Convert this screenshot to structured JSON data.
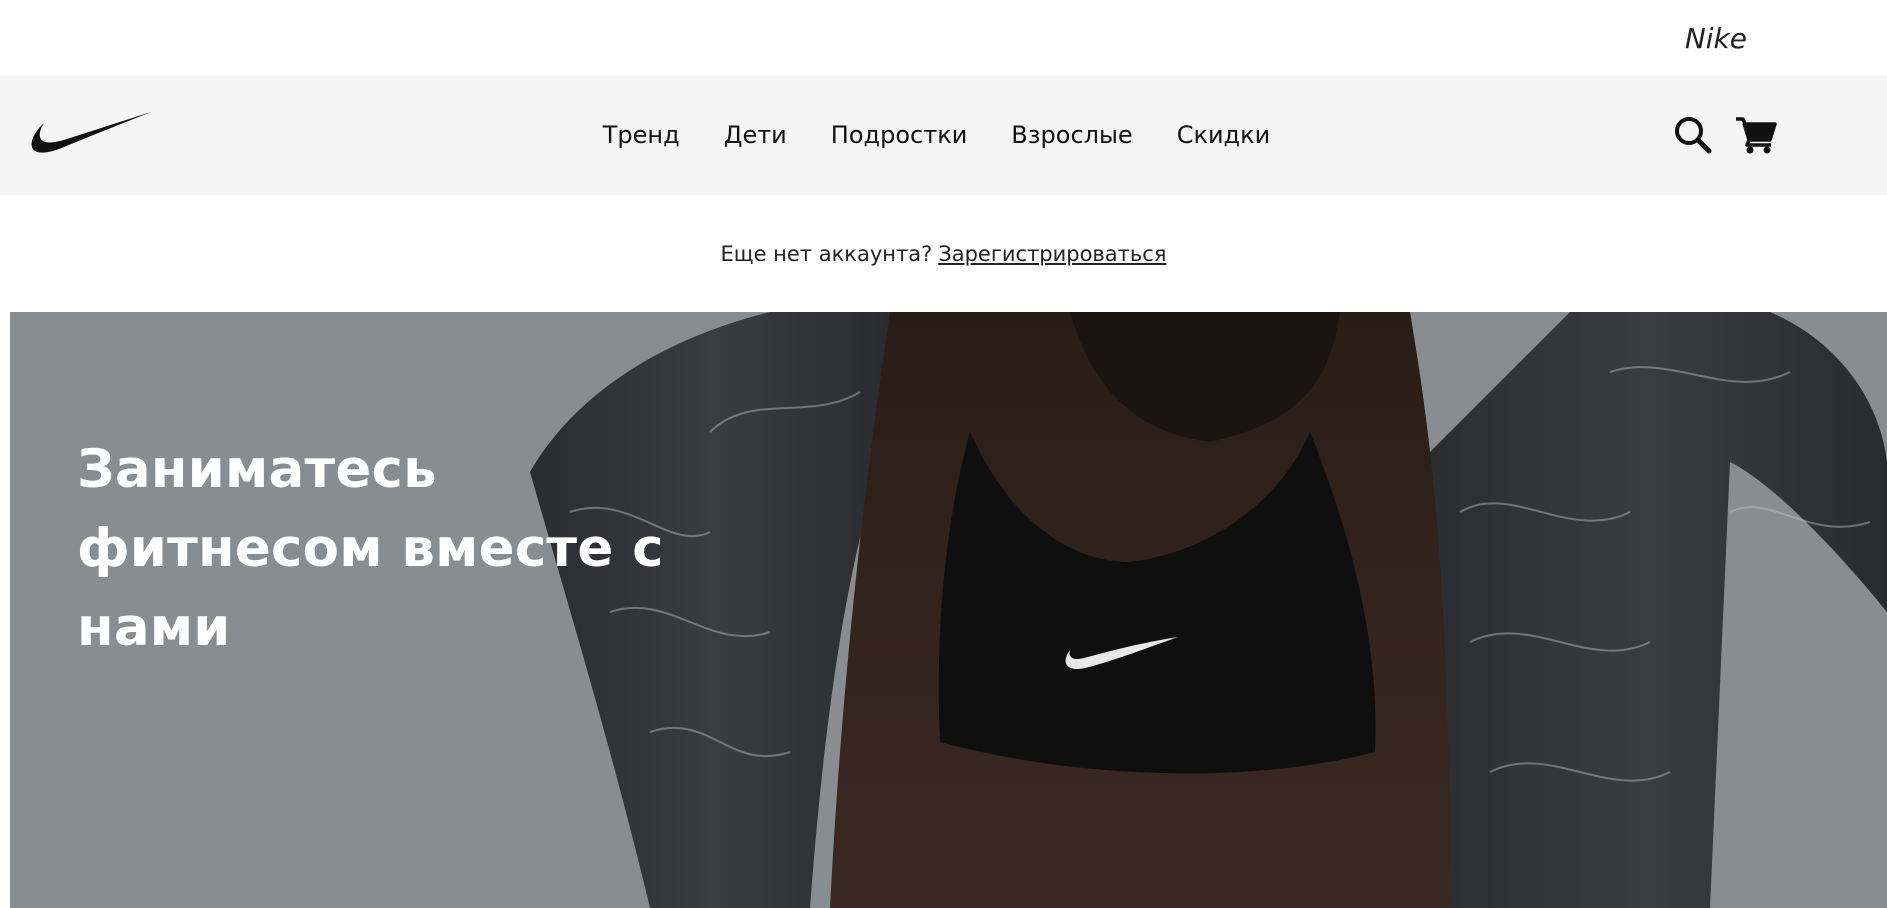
{
  "top_bar": {
    "brand": "Nike"
  },
  "header": {
    "logo_icon": "nike-swoosh-icon",
    "nav": [
      {
        "label": "Тренд"
      },
      {
        "label": "Дети"
      },
      {
        "label": "Подростки"
      },
      {
        "label": "Взрослые"
      },
      {
        "label": "Скидки"
      }
    ],
    "icons": [
      "search-icon",
      "cart-icon"
    ]
  },
  "register": {
    "prompt": "Еще нет аккаунта?",
    "link": "Зарегистрироваться"
  },
  "hero": {
    "title": "Заниматесь фитнесом вместе с нами"
  },
  "colors": {
    "header_bg": "#f5f5f5",
    "hero_bg": "#8a8e93",
    "hero_text": "#ffffff",
    "text": "#111111"
  }
}
